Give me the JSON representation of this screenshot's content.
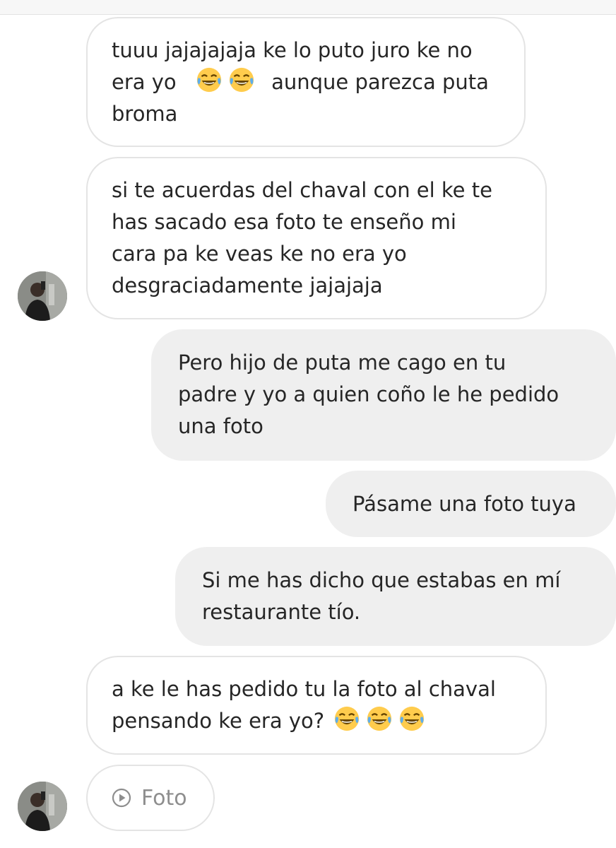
{
  "messages": [
    {
      "sender": "them",
      "lines": [
        "tuuu jajajajaja ke lo puto juro ke no",
        "era yo",
        "aunque parezca puta",
        "broma"
      ],
      "emoji": "face-with-tears-of-joy"
    },
    {
      "sender": "them",
      "lines": [
        "si te acuerdas del chaval con el ke te",
        "has sacado esa foto te enseño mi",
        "cara pa ke veas ke no era yo",
        "desgraciadamente jajajaja"
      ]
    },
    {
      "sender": "me",
      "lines": [
        "Pero hijo de puta me cago en tu",
        "padre y yo a quien coño le he pedido",
        "una foto"
      ]
    },
    {
      "sender": "me",
      "lines": [
        "Pásame una foto tuya"
      ]
    },
    {
      "sender": "me",
      "lines": [
        "Si me has dicho que estabas en mí",
        "restaurante tío."
      ]
    },
    {
      "sender": "them",
      "lines": [
        "a ke le has pedido tu la foto al chaval",
        "pensando ke era yo?"
      ],
      "emoji": "face-with-tears-of-joy"
    }
  ],
  "attachment": {
    "label": "Foto",
    "icon": "play-circle-icon"
  },
  "colors": {
    "incoming_bg": "#ffffff",
    "incoming_border": "#e4e4e4",
    "outgoing_bg": "#efefef",
    "text": "#262626",
    "muted": "#8e8e8e"
  }
}
